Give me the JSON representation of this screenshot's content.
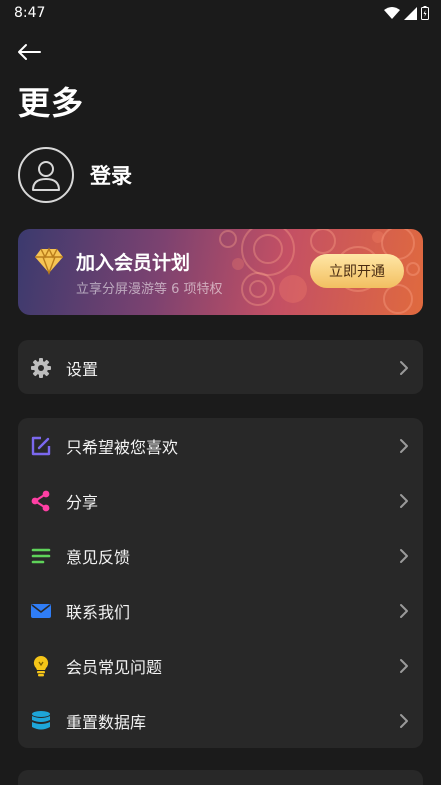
{
  "status_bar": {
    "time": "8:47"
  },
  "header": {
    "title": "更多"
  },
  "login": {
    "label": "登录"
  },
  "vip": {
    "title": "加入会员计划",
    "subtitle": "立享分屏漫游等 6 项特权",
    "button": "立即开通",
    "colors": {
      "button": "#f2bf61",
      "icon": "#f6c453"
    }
  },
  "settings": {
    "label": "设置",
    "icon": "gear-icon"
  },
  "menu": {
    "items": [
      {
        "label": "只希望被您喜欢",
        "icon": "edit-icon",
        "color": "#7b68ee"
      },
      {
        "label": "分享",
        "icon": "share-icon",
        "color": "#ff3fa4"
      },
      {
        "label": "意见反馈",
        "icon": "feedback-lines-icon",
        "color": "#5fd35a"
      },
      {
        "label": "联系我们",
        "icon": "mail-icon",
        "color": "#2f7df6"
      },
      {
        "label": "会员常见问题",
        "icon": "lightbulb-icon",
        "color": "#f5c518"
      },
      {
        "label": "重置数据库",
        "icon": "database-icon",
        "color": "#1ea5d8"
      }
    ]
  }
}
